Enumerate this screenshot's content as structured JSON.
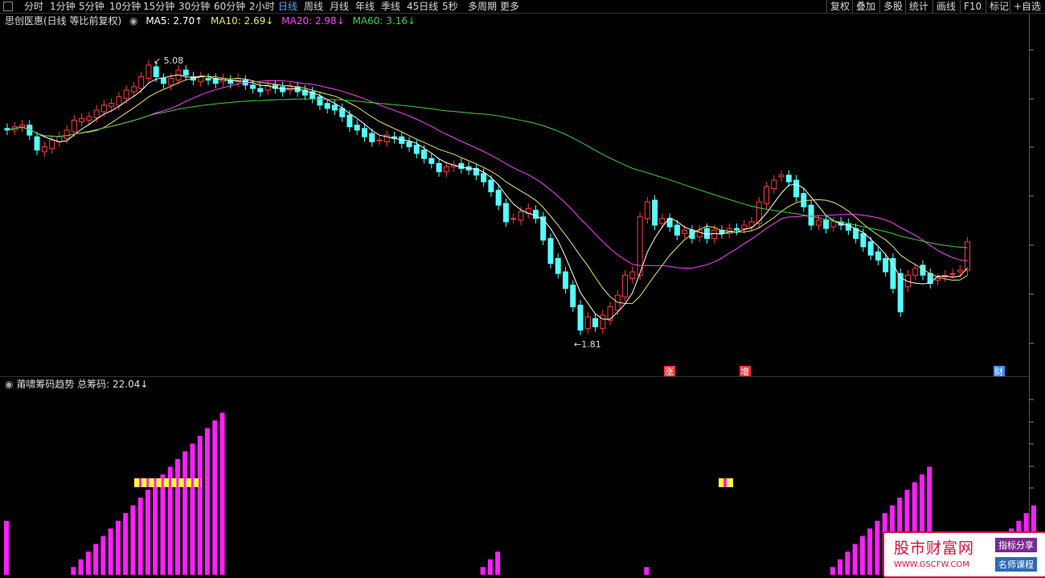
{
  "toolbar": {
    "timeframes": [
      "分时",
      "1分钟",
      "5分钟",
      "10分钟",
      "15分钟",
      "30分钟",
      "60分钟",
      "2小时",
      "日线",
      "周线",
      "月线",
      "年线",
      "季线",
      "45日线",
      "5秒",
      "多周期",
      "更多"
    ],
    "active": "日线",
    "right": [
      "复权",
      "叠加",
      "多股",
      "统计",
      "画线",
      "F10",
      "标记",
      "+自选"
    ]
  },
  "legend": {
    "title": "思创医惠(日线 等比前复权)",
    "ma5": "MA5: 2.70↑",
    "ma10": "MA10: 2.69↓",
    "ma20": "MA20: 2.98↓",
    "ma60": "MA60: 3.16↓"
  },
  "colors": {
    "up": "#ff3b3b",
    "down": "#54ffff",
    "ma5": "#ffffff",
    "ma10": "#e8e46a",
    "ma20": "#ff40ff",
    "ma60": "#40d040",
    "bar": "#ff1fff",
    "barTop": "#ffff33",
    "marker": "#ff3333",
    "markerCai": "#3b8cff"
  },
  "price_labels": {
    "high": "5.08",
    "low": "1.81"
  },
  "events": {
    "zhang": "涨",
    "zeng": "增",
    "cai": "财"
  },
  "indicator": {
    "title": "莆啸筹码趋势",
    "total": "总筹码: 22.04↓"
  },
  "watermark": {
    "main": "股市财富网",
    "url": "WWW.GSCFW.COM",
    "tag1": "指标分享",
    "tag2": "名师课程"
  },
  "chart_data": {
    "type": "candlestick",
    "opens": [
      4.32,
      4.3,
      4.34,
      4.36,
      4.22,
      4.04,
      4.08,
      4.16,
      4.2,
      4.28,
      4.4,
      4.42,
      4.45,
      4.52,
      4.58,
      4.6,
      4.68,
      4.76,
      4.8,
      4.92,
      5.06,
      4.92,
      4.84,
      4.9,
      5.02,
      4.94,
      4.88,
      4.92,
      4.92,
      4.88,
      4.9,
      4.88,
      4.9,
      4.84,
      4.8,
      4.78,
      4.84,
      4.82,
      4.78,
      4.82,
      4.78,
      4.76,
      4.7,
      4.62,
      4.6,
      4.56,
      4.48,
      4.36,
      4.32,
      4.26,
      4.18,
      4.16,
      4.22,
      4.22,
      4.16,
      4.12,
      4.06,
      3.96,
      3.9,
      3.8,
      3.86,
      3.9,
      3.86,
      3.84,
      3.78,
      3.7,
      3.58,
      3.42,
      3.24,
      3.22,
      3.3,
      3.34,
      3.26,
      3.0,
      2.76,
      2.6,
      2.44,
      2.2,
      1.92,
      2.04,
      1.92,
      2.02,
      2.14,
      2.3,
      2.52,
      2.56,
      3.24,
      3.46,
      3.18,
      3.24,
      3.16,
      3.06,
      3.1,
      3.02,
      3.12,
      3.0,
      3.1,
      3.06,
      3.12,
      3.12,
      3.14,
      3.18,
      3.42,
      3.6,
      3.74,
      3.76,
      3.7,
      3.54,
      3.4,
      3.16,
      3.22,
      3.14,
      3.2,
      3.18,
      3.12,
      3.06,
      2.96,
      2.84,
      2.76,
      2.76,
      2.58,
      2.42,
      2.56,
      2.68,
      2.58,
      2.5,
      2.54,
      2.58,
      2.6,
      2.62
    ],
    "closes": [
      4.3,
      4.34,
      4.36,
      4.24,
      4.06,
      4.1,
      4.18,
      4.22,
      4.3,
      4.42,
      4.44,
      4.46,
      4.54,
      4.6,
      4.62,
      4.7,
      4.78,
      4.82,
      4.94,
      5.08,
      4.94,
      4.86,
      4.92,
      5.02,
      4.96,
      4.9,
      4.94,
      4.9,
      4.86,
      4.92,
      4.86,
      4.92,
      4.84,
      4.8,
      4.76,
      4.84,
      4.8,
      4.76,
      4.82,
      4.76,
      4.72,
      4.68,
      4.6,
      4.56,
      4.54,
      4.46,
      4.34,
      4.3,
      4.22,
      4.16,
      4.18,
      4.24,
      4.2,
      4.14,
      4.1,
      4.02,
      3.96,
      3.9,
      3.8,
      3.86,
      3.88,
      3.84,
      3.82,
      3.76,
      3.68,
      3.56,
      3.4,
      3.2,
      3.24,
      3.32,
      3.36,
      3.24,
      2.98,
      2.7,
      2.58,
      2.4,
      2.18,
      1.9,
      2.06,
      1.94,
      2.08,
      2.18,
      2.32,
      2.56,
      2.6,
      3.26,
      3.44,
      3.16,
      3.24,
      3.14,
      3.04,
      3.1,
      3.0,
      3.1,
      3.0,
      3.1,
      3.06,
      3.12,
      3.1,
      3.16,
      3.2,
      3.44,
      3.62,
      3.7,
      3.76,
      3.68,
      3.5,
      3.38,
      3.16,
      3.22,
      3.12,
      3.2,
      3.16,
      3.1,
      3.0,
      2.9,
      2.8,
      2.74,
      2.6,
      2.4,
      2.12,
      2.56,
      2.64,
      2.56,
      2.46,
      2.52,
      2.56,
      2.58,
      2.62,
      2.96
    ],
    "bars": [
      7,
      0,
      0,
      0,
      0,
      0,
      0,
      0,
      0,
      1,
      2,
      3,
      4,
      5,
      6,
      7,
      8,
      9,
      10,
      11,
      12,
      13,
      14,
      15,
      16,
      17,
      18,
      19,
      20,
      21,
      0,
      0,
      0,
      0,
      0,
      0,
      0,
      0,
      0,
      0,
      0,
      0,
      0,
      0,
      0,
      0,
      0,
      0,
      0,
      0,
      0,
      0,
      0,
      0,
      0,
      0,
      0,
      0,
      0,
      0,
      0,
      0,
      0,
      0,
      1,
      2,
      3,
      0,
      0,
      0,
      0,
      0,
      0,
      0,
      0,
      0,
      0,
      0,
      0,
      0,
      0,
      0,
      0,
      0,
      0,
      0,
      1,
      0,
      0,
      0,
      0,
      0,
      0,
      0,
      0,
      0,
      0,
      0,
      0,
      0,
      0,
      0,
      0,
      0,
      0,
      0,
      0,
      0,
      0,
      0,
      0,
      1,
      2,
      3,
      4,
      5,
      6,
      7,
      8,
      9,
      10,
      11,
      12,
      13,
      14,
      0,
      0,
      0,
      0,
      0,
      1,
      2,
      3,
      4,
      5,
      6,
      7,
      8,
      9,
      0,
      0,
      0,
      0,
      0,
      0,
      0,
      0,
      0,
      0,
      0,
      0,
      0,
      0,
      0,
      0,
      0,
      0,
      0,
      0,
      0,
      0,
      0,
      0
    ],
    "high_marks": [
      19,
      2
    ],
    "low": 1.81,
    "high": 5.08
  }
}
